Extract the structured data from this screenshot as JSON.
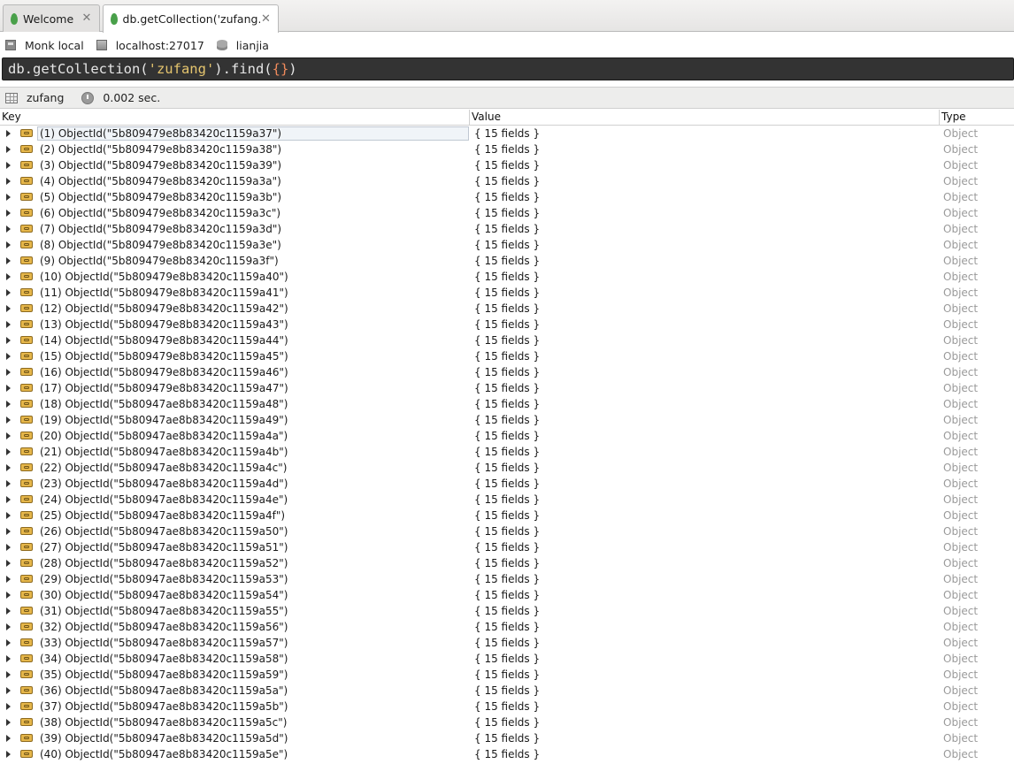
{
  "tabs": [
    {
      "label": "Welcome",
      "active": false
    },
    {
      "label": "db.getCollection('zufang...",
      "active": true
    }
  ],
  "connection": {
    "name": "Monk local",
    "server": "localhost:27017",
    "database": "lianjia"
  },
  "query": {
    "prefix": "db.getCollection(",
    "arg": "'zufang'",
    "mid": ").find(",
    "braces": "{}",
    "suffix": ")"
  },
  "result_bar": {
    "collection": "zufang",
    "time": "0.002 sec."
  },
  "columns": {
    "key": "Key",
    "value": "Value",
    "type": "Type"
  },
  "rows": [
    {
      "key": "(1) ObjectId(\"5b809479e8b83420c1159a37\")",
      "value": "{ 15 fields }",
      "type": "Object"
    },
    {
      "key": "(2) ObjectId(\"5b809479e8b83420c1159a38\")",
      "value": "{ 15 fields }",
      "type": "Object"
    },
    {
      "key": "(3) ObjectId(\"5b809479e8b83420c1159a39\")",
      "value": "{ 15 fields }",
      "type": "Object"
    },
    {
      "key": "(4) ObjectId(\"5b809479e8b83420c1159a3a\")",
      "value": "{ 15 fields }",
      "type": "Object"
    },
    {
      "key": "(5) ObjectId(\"5b809479e8b83420c1159a3b\")",
      "value": "{ 15 fields }",
      "type": "Object"
    },
    {
      "key": "(6) ObjectId(\"5b809479e8b83420c1159a3c\")",
      "value": "{ 15 fields }",
      "type": "Object"
    },
    {
      "key": "(7) ObjectId(\"5b809479e8b83420c1159a3d\")",
      "value": "{ 15 fields }",
      "type": "Object"
    },
    {
      "key": "(8) ObjectId(\"5b809479e8b83420c1159a3e\")",
      "value": "{ 15 fields }",
      "type": "Object"
    },
    {
      "key": "(9) ObjectId(\"5b809479e8b83420c1159a3f\")",
      "value": "{ 15 fields }",
      "type": "Object"
    },
    {
      "key": "(10) ObjectId(\"5b809479e8b83420c1159a40\")",
      "value": "{ 15 fields }",
      "type": "Object"
    },
    {
      "key": "(11) ObjectId(\"5b809479e8b83420c1159a41\")",
      "value": "{ 15 fields }",
      "type": "Object"
    },
    {
      "key": "(12) ObjectId(\"5b809479e8b83420c1159a42\")",
      "value": "{ 15 fields }",
      "type": "Object"
    },
    {
      "key": "(13) ObjectId(\"5b809479e8b83420c1159a43\")",
      "value": "{ 15 fields }",
      "type": "Object"
    },
    {
      "key": "(14) ObjectId(\"5b809479e8b83420c1159a44\")",
      "value": "{ 15 fields }",
      "type": "Object"
    },
    {
      "key": "(15) ObjectId(\"5b809479e8b83420c1159a45\")",
      "value": "{ 15 fields }",
      "type": "Object"
    },
    {
      "key": "(16) ObjectId(\"5b809479e8b83420c1159a46\")",
      "value": "{ 15 fields }",
      "type": "Object"
    },
    {
      "key": "(17) ObjectId(\"5b809479e8b83420c1159a47\")",
      "value": "{ 15 fields }",
      "type": "Object"
    },
    {
      "key": "(18) ObjectId(\"5b80947ae8b83420c1159a48\")",
      "value": "{ 15 fields }",
      "type": "Object"
    },
    {
      "key": "(19) ObjectId(\"5b80947ae8b83420c1159a49\")",
      "value": "{ 15 fields }",
      "type": "Object"
    },
    {
      "key": "(20) ObjectId(\"5b80947ae8b83420c1159a4a\")",
      "value": "{ 15 fields }",
      "type": "Object"
    },
    {
      "key": "(21) ObjectId(\"5b80947ae8b83420c1159a4b\")",
      "value": "{ 15 fields }",
      "type": "Object"
    },
    {
      "key": "(22) ObjectId(\"5b80947ae8b83420c1159a4c\")",
      "value": "{ 15 fields }",
      "type": "Object"
    },
    {
      "key": "(23) ObjectId(\"5b80947ae8b83420c1159a4d\")",
      "value": "{ 15 fields }",
      "type": "Object"
    },
    {
      "key": "(24) ObjectId(\"5b80947ae8b83420c1159a4e\")",
      "value": "{ 15 fields }",
      "type": "Object"
    },
    {
      "key": "(25) ObjectId(\"5b80947ae8b83420c1159a4f\")",
      "value": "{ 15 fields }",
      "type": "Object"
    },
    {
      "key": "(26) ObjectId(\"5b80947ae8b83420c1159a50\")",
      "value": "{ 15 fields }",
      "type": "Object"
    },
    {
      "key": "(27) ObjectId(\"5b80947ae8b83420c1159a51\")",
      "value": "{ 15 fields }",
      "type": "Object"
    },
    {
      "key": "(28) ObjectId(\"5b80947ae8b83420c1159a52\")",
      "value": "{ 15 fields }",
      "type": "Object"
    },
    {
      "key": "(29) ObjectId(\"5b80947ae8b83420c1159a53\")",
      "value": "{ 15 fields }",
      "type": "Object"
    },
    {
      "key": "(30) ObjectId(\"5b80947ae8b83420c1159a54\")",
      "value": "{ 15 fields }",
      "type": "Object"
    },
    {
      "key": "(31) ObjectId(\"5b80947ae8b83420c1159a55\")",
      "value": "{ 15 fields }",
      "type": "Object"
    },
    {
      "key": "(32) ObjectId(\"5b80947ae8b83420c1159a56\")",
      "value": "{ 15 fields }",
      "type": "Object"
    },
    {
      "key": "(33) ObjectId(\"5b80947ae8b83420c1159a57\")",
      "value": "{ 15 fields }",
      "type": "Object"
    },
    {
      "key": "(34) ObjectId(\"5b80947ae8b83420c1159a58\")",
      "value": "{ 15 fields }",
      "type": "Object"
    },
    {
      "key": "(35) ObjectId(\"5b80947ae8b83420c1159a59\")",
      "value": "{ 15 fields }",
      "type": "Object"
    },
    {
      "key": "(36) ObjectId(\"5b80947ae8b83420c1159a5a\")",
      "value": "{ 15 fields }",
      "type": "Object"
    },
    {
      "key": "(37) ObjectId(\"5b80947ae8b83420c1159a5b\")",
      "value": "{ 15 fields }",
      "type": "Object"
    },
    {
      "key": "(38) ObjectId(\"5b80947ae8b83420c1159a5c\")",
      "value": "{ 15 fields }",
      "type": "Object"
    },
    {
      "key": "(39) ObjectId(\"5b80947ae8b83420c1159a5d\")",
      "value": "{ 15 fields }",
      "type": "Object"
    },
    {
      "key": "(40) ObjectId(\"5b80947ae8b83420c1159a5e\")",
      "value": "{ 15 fields }",
      "type": "Object"
    }
  ]
}
